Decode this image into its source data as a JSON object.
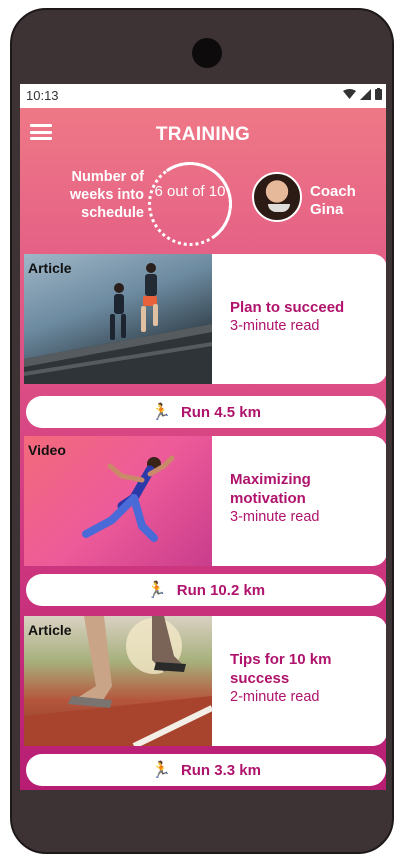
{
  "status": {
    "time": "10:13"
  },
  "header": {
    "title": "TRAINING"
  },
  "weeks": {
    "label": "Number of weeks into schedule",
    "value": "6 out of 10"
  },
  "coach": {
    "label": "Coach Gina"
  },
  "cards": [
    {
      "tag": "Article",
      "title": "Plan to succeed",
      "subtitle": "3-minute read",
      "run": "Run 4.5 km"
    },
    {
      "tag": "Video",
      "title": "Maximizing motivation",
      "subtitle": "3-minute read",
      "run": "Run 10.2 km"
    },
    {
      "tag": "Article",
      "title": "Tips for 10 km success",
      "subtitle": "2-minute read",
      "run": "Run 3.3 km"
    }
  ],
  "icons": {
    "menu": "menu-icon",
    "wifi": "wifi-icon",
    "signal": "signal-icon",
    "battery": "battery-icon",
    "run": "runner-icon"
  },
  "colors": {
    "accent": "#b0136c",
    "gradient_top": "#f07c86",
    "gradient_bottom": "#b71c73"
  }
}
